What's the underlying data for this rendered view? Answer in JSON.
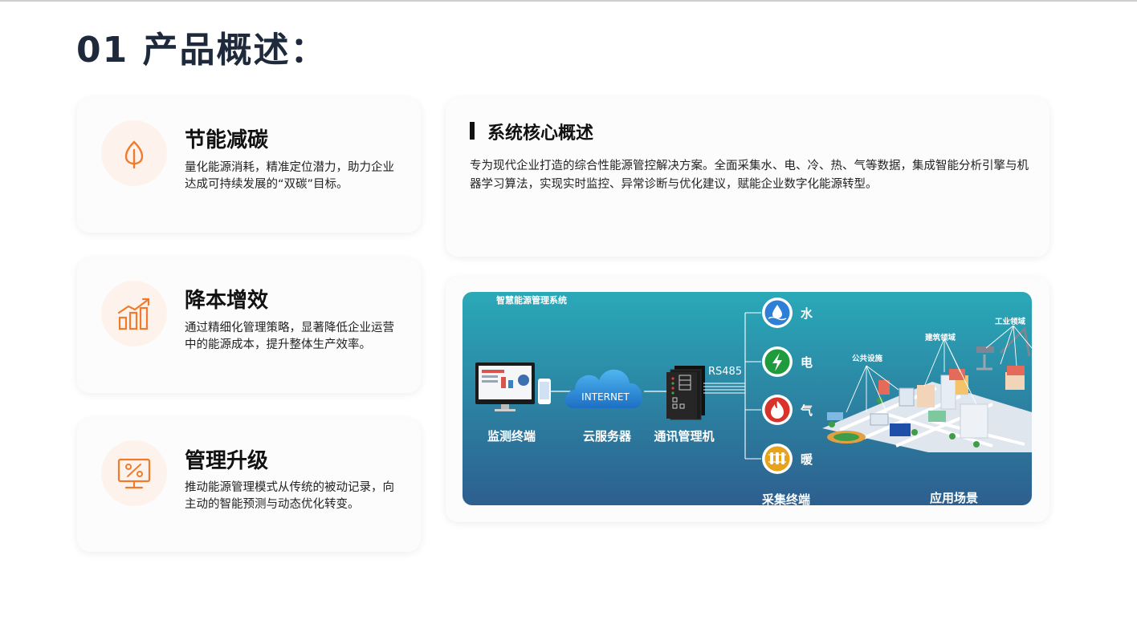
{
  "page": {
    "title": "01 产品概述："
  },
  "features": [
    {
      "title": "节能减碳",
      "desc": "量化能源消耗，精准定位潜力，助力企业达成可持续发展的“双碳”目标。",
      "icon": "leaf-icon"
    },
    {
      "title": "降本增效",
      "desc": "通过精细化管理策略，显著降低企业运营中的能源成本，提升整体生产效率。",
      "icon": "bar-chart-growth-icon"
    },
    {
      "title": "管理升级",
      "desc": "推动能源管理模式从传统的被动记录，向主动的智能预测与动态优化转变。",
      "icon": "monitor-percent-icon"
    }
  ],
  "overview": {
    "title": "系统核心概述",
    "desc": "专为现代企业打造的综合性能源管控解决方案。全面采集水、电、冷、热、气等数据，集成智能分析引擎与机器学习算法，实现实时监控、异常诊断与优化建议，赋能企业数字化能源转型。"
  },
  "diagram": {
    "heading": "智慧能源管理系统",
    "cloud_label": "INTERNET",
    "protocol": "RS485",
    "nodes": [
      "监测终端",
      "云服务器",
      "通讯管理机"
    ],
    "collectors": [
      {
        "label": "水",
        "icon": "water-drop-icon",
        "color": "#2f7fd6"
      },
      {
        "label": "电",
        "icon": "lightning-icon",
        "color": "#1f9a3c"
      },
      {
        "label": "气",
        "icon": "flame-icon",
        "color": "#d8322a"
      },
      {
        "label": "暖",
        "icon": "radiator-icon",
        "color": "#e8a21b"
      }
    ],
    "collector_caption": "采集终端",
    "scene_caption": "应用场景",
    "scene_tags": [
      "公共设施",
      "建筑领域",
      "工业领域"
    ]
  },
  "colors": {
    "accent": "#f07b2c",
    "title": "#1e2a3c",
    "diagram_top": "#2aa9b8",
    "diagram_bottom": "#2d5f8e"
  }
}
